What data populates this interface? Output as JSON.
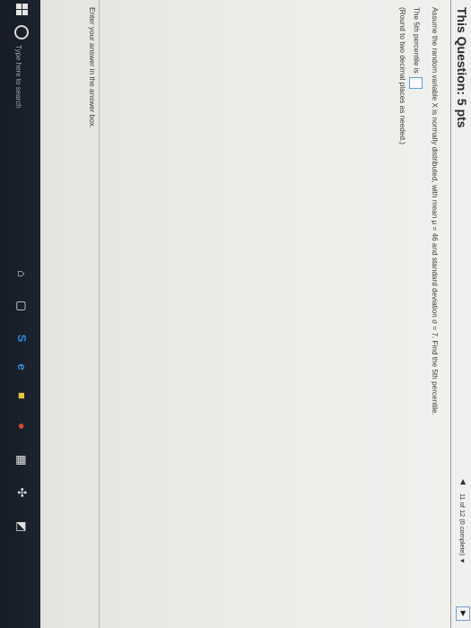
{
  "header": {
    "title": "This Question: 5 pts",
    "nav_prev": "◀",
    "progress": "11 of 12 (0 complete)",
    "nav_dropdown": "▼",
    "nav_next": "▶"
  },
  "question": {
    "text": "Assume the random variable X is normally distributed, with mean μ = 46 and standard deviation σ = 7. Find the 5th percentile.",
    "answer_prefix": "The 5th percentile is",
    "answer_value": "",
    "round_note": "(Round to two decimal places as needed.)"
  },
  "footer": {
    "help": "Enter your answer in the answer box."
  },
  "taskbar": {
    "search_placeholder": "Type here to search",
    "icons": [
      "windows-start-icon",
      "search-icon",
      "microphone-icon",
      "task-view-icon",
      "skype-icon",
      "edge-icon",
      "file-explorer-icon",
      "chrome-icon",
      "store-icon",
      "settings-icon",
      "photos-icon"
    ]
  }
}
